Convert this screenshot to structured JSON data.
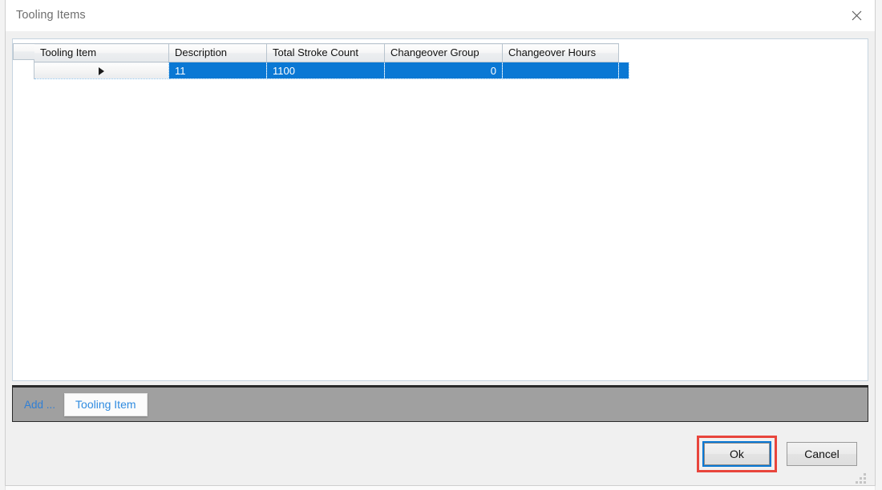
{
  "window": {
    "title": "Tooling Items",
    "close_icon": "close-icon"
  },
  "grid": {
    "columns": [
      "Tooling Item",
      "Description",
      "Total Stroke Count",
      "Changeover Group",
      "Changeover Hours"
    ],
    "rows": [
      {
        "indicator": "current-row-arrow",
        "tooling_item": "11",
        "description": "1100",
        "total_stroke_count": "0",
        "changeover_group": "",
        "changeover_hours": ""
      }
    ]
  },
  "command_bar": {
    "add_label": "Add ...",
    "add_tooling_item_label": "Tooling Item"
  },
  "footer": {
    "ok_label": "Ok",
    "cancel_label": "Cancel"
  },
  "colors": {
    "selection_blue": "#0a78d4",
    "command_bar_gray": "#a0a0a0",
    "highlight_red": "#e8453c",
    "focus_blue": "#0a78d4",
    "link_blue": "#2f8be0",
    "title_text": "#6e6e6e"
  }
}
